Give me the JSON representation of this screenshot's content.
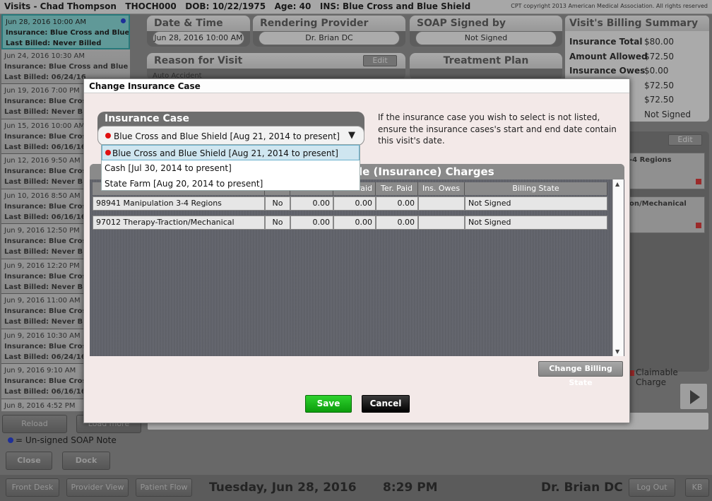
{
  "titlebar": {
    "text": "Visits - Chad Thompson   THOCH000   DOB: 10/22/1975   Age: 40   INS: Blue Cross and Blue Shield",
    "copyright": "CPT copyright 2013 American Medical Association. All rights reserved"
  },
  "visits": [
    {
      "date": "Jun 28, 2016 10:00 AM",
      "insurance": "Insurance: Blue Cross and Blue S",
      "billed": "Last Billed: Never Billed",
      "active": true
    },
    {
      "date": "Jun 24, 2016 10:30 AM",
      "insurance": "Insurance: Blue Cross and Blue S",
      "billed": "Last Billed: 06/24/16"
    },
    {
      "date": "Jun 19, 2016 7:00 PM",
      "insurance": "Insurance: Blue Cros",
      "billed": "Last Billed: Never Bil"
    },
    {
      "date": "Jun 15, 2016 10:00 AM",
      "insurance": "Insurance: Blue Cros",
      "billed": "Last Billed: 06/16/16"
    },
    {
      "date": "Jun 12, 2016 9:50 AM",
      "insurance": "Insurance: Blue Cros",
      "billed": "Last Billed: Never Bil"
    },
    {
      "date": "Jun 10, 2016 8:50 AM",
      "insurance": "Insurance: Blue Cros",
      "billed": "Last Billed: 06/16/16"
    },
    {
      "date": "Jun 9, 2016 12:50 PM",
      "insurance": "Insurance: Blue Cros",
      "billed": "Last Billed: Never Bil"
    },
    {
      "date": "Jun 9, 2016 12:20 PM",
      "insurance": "Insurance: Blue Cros",
      "billed": "Last Billed: Never Bil"
    },
    {
      "date": "Jun 9, 2016 11:00 AM",
      "insurance": "Insurance: Blue Cros",
      "billed": "Last Billed: Never Bil"
    },
    {
      "date": "Jun 9, 2016 10:30 AM",
      "insurance": "Insurance: Blue Cros",
      "billed": "Last Billed: 06/24/16"
    },
    {
      "date": "Jun 9, 2016 9:10 AM",
      "insurance": "Insurance: Blue Cros",
      "billed": "Last Billed: 06/16/16"
    },
    {
      "date": "Jun 8, 2016 4:52 PM",
      "insurance": "",
      "billed": ""
    }
  ],
  "panels": {
    "date_time_label": "Date & Time",
    "date_time_value": "Jun 28, 2016 10:00 AM",
    "provider_label": "Rendering Provider",
    "provider_value": "Dr. Brian DC",
    "soap_label": "SOAP Signed by",
    "soap_value": "Not Signed",
    "reason_label": "Reason for Visit",
    "reason_edit": "Edit",
    "reason_value": "Auto Accident",
    "plan_label": "Treatment Plan"
  },
  "billing_summary": {
    "title": "Visit's Billing Summary",
    "rows": [
      {
        "label": "Insurance Total",
        "value": "$80.00"
      },
      {
        "label": "Amount Allowed",
        "value": "$72.50"
      },
      {
        "label": "Insurance Owes",
        "value": "$0.00"
      },
      {
        "label": "",
        "value": "$72.50"
      },
      {
        "label": "",
        "value": "$72.50"
      },
      {
        "label": "",
        "value": "Not Signed"
      }
    ]
  },
  "right_panel": {
    "edit": "Edit",
    "items": [
      "-4 Regions",
      "on/Mechanical"
    ],
    "claimable": "Claimable Charge"
  },
  "left_buttons": {
    "reload": "Reload",
    "load_more": "Load more",
    "legend": "= Un-signed SOAP Note",
    "close": "Close",
    "dock": "Dock"
  },
  "footer": {
    "front_desk": "Front Desk",
    "provider_view": "Provider View",
    "patient_flow": "Patient Flow",
    "date": "Tuesday, Jun 28, 2016",
    "time": "8:29 PM",
    "doctor": "Dr. Brian DC",
    "logout": "Log Out",
    "kb": "KB"
  },
  "modal": {
    "title": "Change Insurance Case",
    "insurance_case_label": "Insurance Case",
    "selected": "Blue Cross and Blue Shield [Aug 21, 2014 to present]",
    "note": "If the insurance case you wish to select is not listed, ensure the insurance cases's start and end date contain this visit's date.",
    "options": [
      "Blue Cross and Blue Shield [Aug 21, 2014 to present]",
      "Cash [Jul 30, 2014 to present]",
      "State Farm [Aug 20, 2014 to present]"
    ],
    "charges_title": "le (Insurance) Charges",
    "columns": [
      "Paid",
      "Ter. Paid",
      "Ins. Owes",
      "Billing State"
    ],
    "rows": [
      {
        "code": "98941  Manipulation 3-4 Regions",
        "flag": "No",
        "a": "0.00",
        "paid": "0.00",
        "ter": "0.00",
        "owes": "",
        "state": "Not Signed"
      },
      {
        "code": "97012  Therapy-Traction/Mechanical",
        "flag": "No",
        "a": "0.00",
        "paid": "0.00",
        "ter": "0.00",
        "owes": "",
        "state": "Not Signed"
      }
    ],
    "change_billing_state": "Change Billing State",
    "save": "Save",
    "cancel": "Cancel"
  },
  "colors": {
    "active_visit": "#7ed6d4",
    "save_green": "#17b517",
    "unsigned_dot": "#1a33d6",
    "claimable_red": "#d92b2b"
  }
}
